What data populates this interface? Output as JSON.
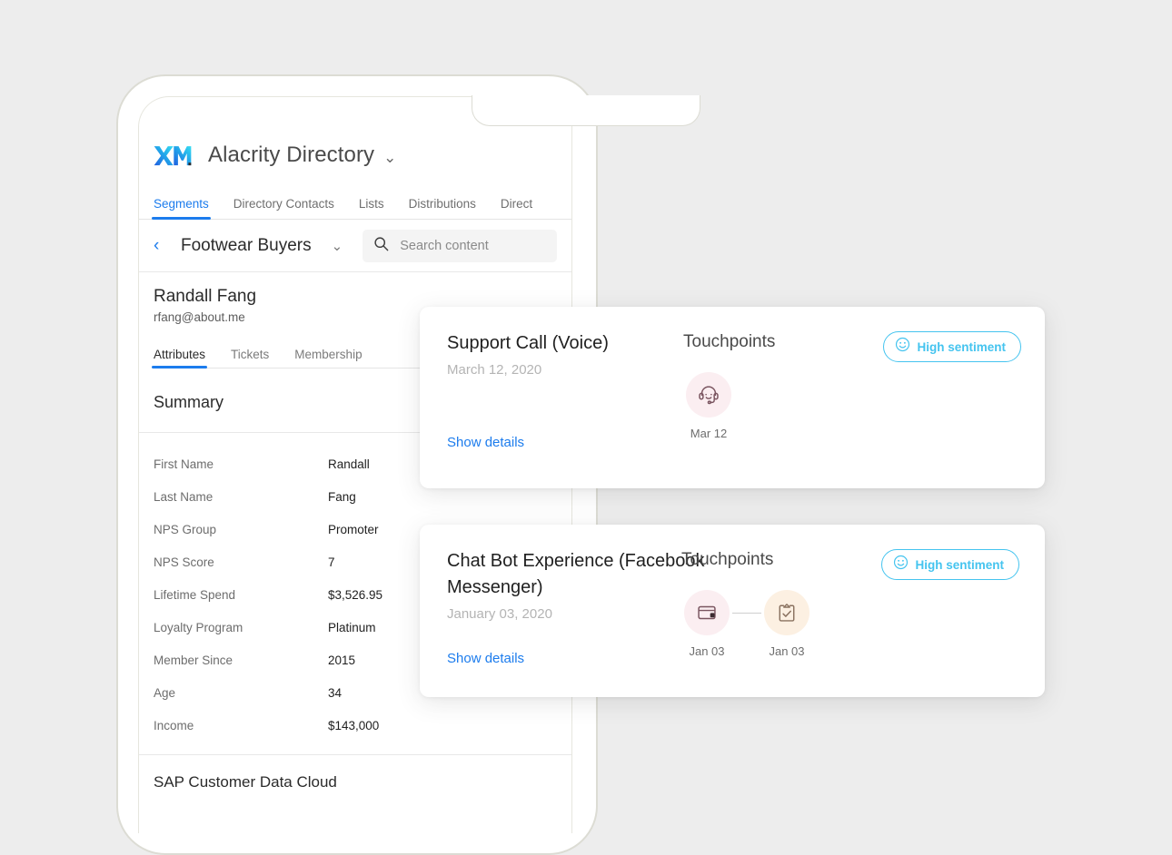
{
  "theme": {
    "page_bg": "#ededed",
    "accent_blue": "#1c7ced",
    "sentiment_cyan": "#45c4ef",
    "logo_gradient_from": "#1f5fe0",
    "logo_gradient_to": "#2ec5ef"
  },
  "phone": {
    "app_header": {
      "logo_name": "xm-logo",
      "directory_title": "Alacrity Directory",
      "directory_caret": "⌄"
    },
    "tabs": [
      {
        "label": "Segments",
        "active": true
      },
      {
        "label": "Directory Contacts",
        "active": false
      },
      {
        "label": "Lists",
        "active": false
      },
      {
        "label": "Distributions",
        "active": false
      },
      {
        "label": "Direct",
        "active": false
      }
    ],
    "segment_bar": {
      "back_chevron": "‹",
      "segment_name": "Footwear Buyers",
      "segment_caret": "⌄",
      "search_placeholder": "Search content",
      "search_value": ""
    },
    "contact": {
      "name": "Randall Fang",
      "email": "rfang@about.me",
      "subtabs": [
        {
          "label": "Attributes",
          "active": true
        },
        {
          "label": "Tickets",
          "active": false
        },
        {
          "label": "Membership",
          "active": false
        }
      ]
    },
    "summary": {
      "title": "Summary",
      "attributes": [
        {
          "key": "First Name",
          "value": "Randall"
        },
        {
          "key": "Last Name",
          "value": "Fang"
        },
        {
          "key": "NPS Group",
          "value": "Promoter"
        },
        {
          "key": "NPS Score",
          "value": "7"
        },
        {
          "key": "Lifetime Spend",
          "value": "$3,526.95"
        },
        {
          "key": "Loyalty Program",
          "value": "Platinum"
        },
        {
          "key": "Member Since",
          "value": "2015"
        },
        {
          "key": "Age",
          "value": "34"
        },
        {
          "key": "Income",
          "value": "$143,000"
        }
      ]
    },
    "next_section": {
      "title": "SAP Customer Data Cloud"
    }
  },
  "cards": [
    {
      "id": "card-support",
      "title": "Support Call (Voice)",
      "date": "March 12, 2020",
      "show_details": "Show details",
      "touchpoints_label": "Touchpoints",
      "sentiment": {
        "label": "High sentiment",
        "icon": "smiley-face-icon"
      },
      "touchpoints": [
        {
          "icon": "headset-support-icon",
          "bubble_color": "#fbeef1",
          "date": "Mar 12"
        }
      ]
    },
    {
      "id": "card-chatbot",
      "title": "Chat Bot Experience (Facebook Messenger)",
      "date": "January 03, 2020",
      "show_details": "Show details",
      "touchpoints_label": "Touchpoints",
      "sentiment": {
        "label": "High sentiment",
        "icon": "smiley-face-icon"
      },
      "touchpoints": [
        {
          "icon": "chat-window-icon",
          "bubble_color": "#fbeef1",
          "date": "Jan 03"
        },
        {
          "icon": "clipboard-check-icon",
          "bubble_color": "#fcf0e2",
          "date": "Jan 03"
        }
      ]
    }
  ]
}
